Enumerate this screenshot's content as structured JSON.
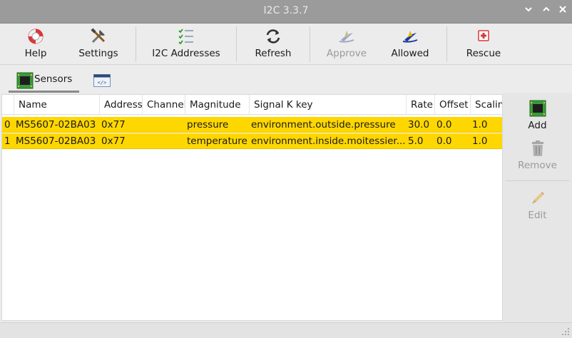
{
  "window": {
    "title": "I2C 3.3.7",
    "controls": [
      "chevron-down-icon",
      "chevron-up-icon",
      "close-icon"
    ]
  },
  "toolbar": {
    "help_label": "Help",
    "settings_label": "Settings",
    "addresses_label": "I2C Addresses",
    "refresh_label": "Refresh",
    "approve_label": "Approve",
    "allowed_label": "Allowed",
    "rescue_label": "Rescue"
  },
  "tabs": [
    {
      "label": "Sensors",
      "icon": "chip-icon",
      "active": true
    },
    {
      "label": "",
      "icon": "code-window-icon",
      "active": false
    }
  ],
  "table": {
    "columns": [
      "",
      "Name",
      "Address",
      "Channel",
      "Magnitude",
      "Signal K key",
      "Rate",
      "Offset",
      "Scalin"
    ],
    "rows": [
      {
        "index": "0",
        "name": "MS5607-02BA03",
        "address": "0x77",
        "channel": "",
        "magnitude": "pressure",
        "sk_key": "environment.outside.pressure",
        "rate": "30.0",
        "offset": "0.0",
        "scaling": "1.0"
      },
      {
        "index": "1",
        "name": "MS5607-02BA03",
        "address": "0x77",
        "channel": "",
        "magnitude": "temperature",
        "sk_key": "environment.inside.moitessier...",
        "rate": "5.0",
        "offset": "0.0",
        "scaling": "1.0"
      }
    ]
  },
  "side": {
    "add_label": "Add",
    "remove_label": "Remove",
    "edit_label": "Edit"
  },
  "colors": {
    "row_highlight": "#ffd700",
    "titlebar": "#9b9b9b",
    "accent_blue": "#1a3a9e"
  }
}
